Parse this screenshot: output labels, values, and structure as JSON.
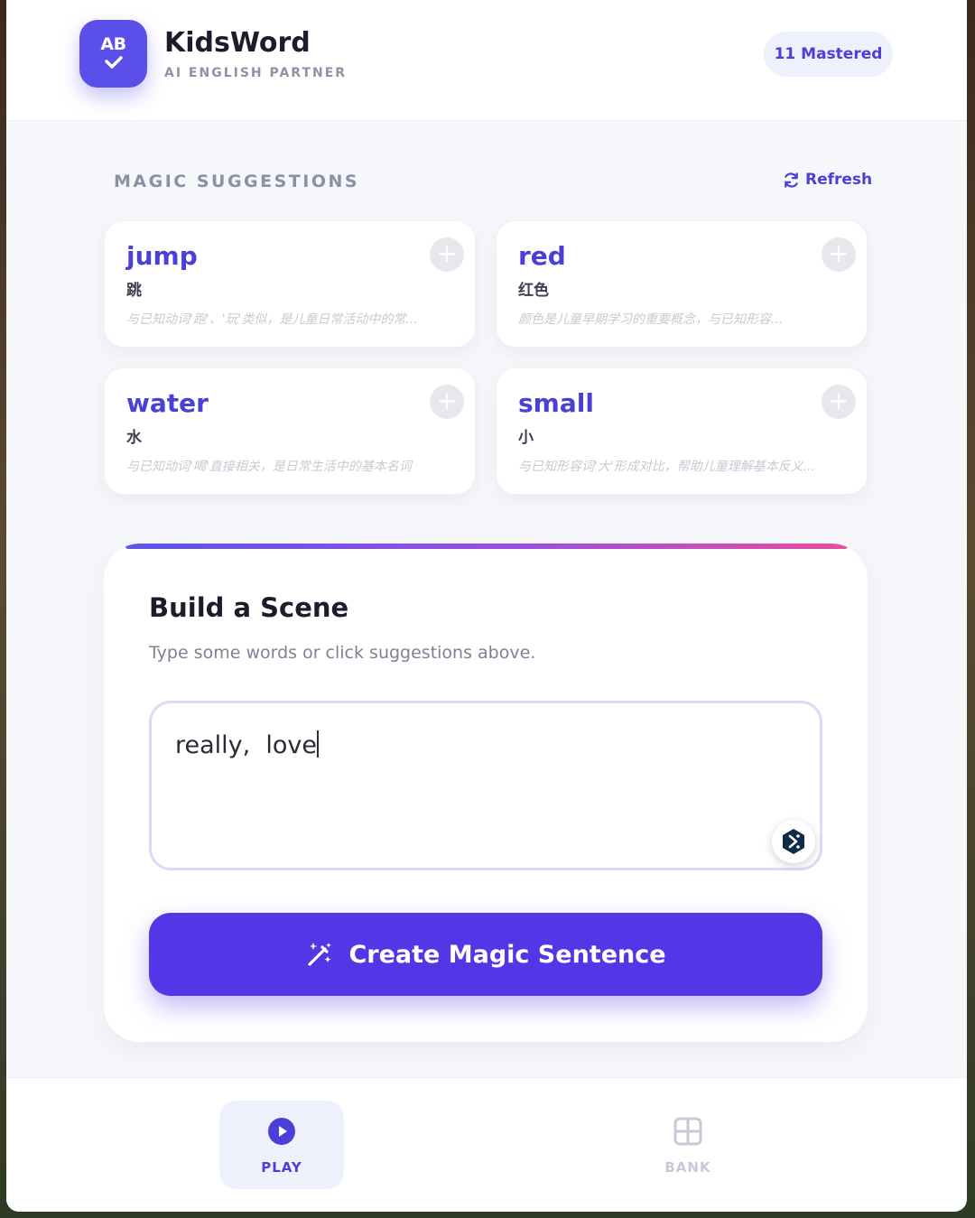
{
  "header": {
    "logo_text": "AB",
    "title": "KidsWord",
    "subtitle": "AI ENGLISH PARTNER",
    "mastered_badge": "11 Mastered"
  },
  "suggestions": {
    "section_label": "MAGIC SUGGESTIONS",
    "refresh_label": "Refresh",
    "cards": [
      {
        "word": "jump",
        "translation": "跳",
        "description": "与已知动词'跑'、'玩'类似，是儿童日常活动中的常..."
      },
      {
        "word": "red",
        "translation": "红色",
        "description": "颜色是儿童早期学习的重要概念，与已知形容..."
      },
      {
        "word": "water",
        "translation": "水",
        "description": "与已知动词'喝'直接相关，是日常生活中的基本名词"
      },
      {
        "word": "small",
        "translation": "小",
        "description": "与已知形容词'大'形成对比，帮助儿童理解基本反义..."
      }
    ]
  },
  "builder": {
    "title": "Build a Scene",
    "subtitle": "Type some words or click suggestions above.",
    "input_value": "really,  love",
    "create_button_label": "Create Magic Sentence"
  },
  "nav": {
    "play_label": "PLAY",
    "bank_label": "BANK"
  },
  "colors": {
    "accent": "#5237e6",
    "accent_text": "#4c3fd8",
    "background": "#f6f7fb"
  }
}
